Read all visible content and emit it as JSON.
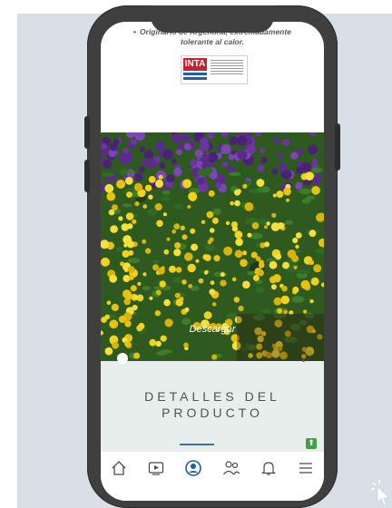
{
  "content": {
    "top_text_line1": "Originario de Argentina, extremadamente",
    "top_text_line2": "tolerante al calor.",
    "logo_text": "INTA"
  },
  "image": {
    "download_label": "Descargar"
  },
  "details": {
    "title_line1": "DETALLES DEL",
    "title_line2": "PRODUCTO"
  },
  "nav": {
    "items": [
      {
        "icon": "home-icon"
      },
      {
        "icon": "video-play-icon"
      },
      {
        "icon": "profile-icon",
        "active": true
      },
      {
        "icon": "users-icon"
      },
      {
        "icon": "bell-icon"
      },
      {
        "icon": "menu-icon"
      }
    ]
  },
  "colors": {
    "accent": "#3b6ea8",
    "scroll_top_button": "#43a047",
    "logo_red": "#c8202f",
    "details_bg": "#e7eeec"
  }
}
